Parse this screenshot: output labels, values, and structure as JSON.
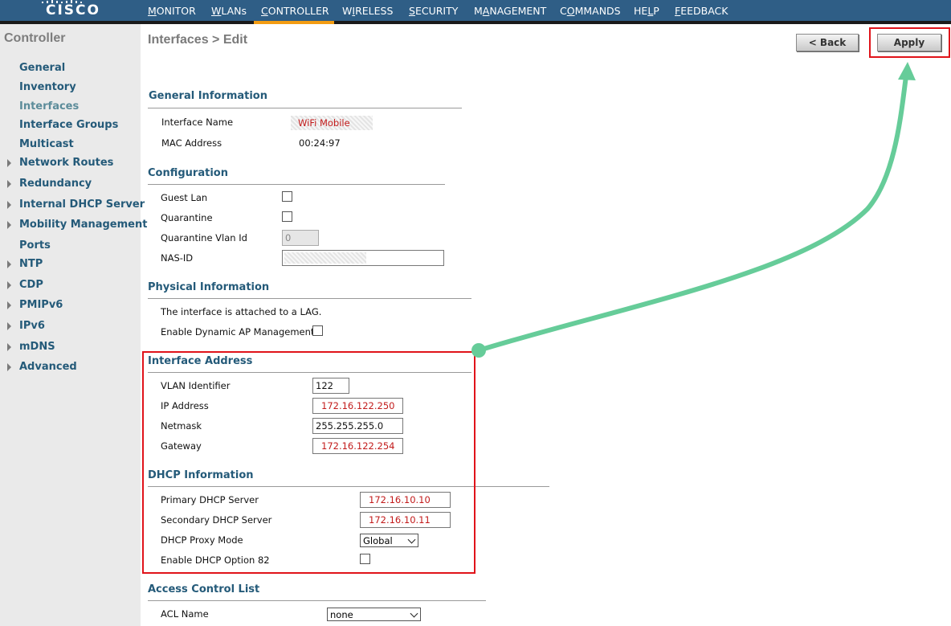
{
  "brand": {
    "logo_text": "CISCO"
  },
  "nav": {
    "items": [
      {
        "pre": "",
        "ul": "M",
        "post": "ONITOR"
      },
      {
        "pre": "",
        "ul": "W",
        "post": "LANs"
      },
      {
        "pre": "",
        "ul": "C",
        "post": "ONTROLLER"
      },
      {
        "pre": "W",
        "ul": "I",
        "post": "RELESS"
      },
      {
        "pre": "",
        "ul": "S",
        "post": "ECURITY"
      },
      {
        "pre": "M",
        "ul": "A",
        "post": "NAGEMENT"
      },
      {
        "pre": "C",
        "ul": "O",
        "post": "MMANDS"
      },
      {
        "pre": "HE",
        "ul": "L",
        "post": "P"
      },
      {
        "pre": "",
        "ul": "F",
        "post": "EEDBACK"
      }
    ],
    "active": "CONTROLLER",
    "active_color": "#f39c12"
  },
  "sidebar": {
    "title": "Controller",
    "items": [
      {
        "label": "General",
        "arrow": false
      },
      {
        "label": "Inventory",
        "arrow": false
      },
      {
        "label": "Interfaces",
        "arrow": false,
        "active": true
      },
      {
        "label": "Interface Groups",
        "arrow": false
      },
      {
        "label": "Multicast",
        "arrow": false
      },
      {
        "label": "Network Routes",
        "arrow": true
      },
      {
        "label": "Redundancy",
        "arrow": true
      },
      {
        "label": "Internal DHCP Server",
        "arrow": true
      },
      {
        "label": "Mobility Management",
        "arrow": true
      },
      {
        "label": "Ports",
        "arrow": false
      },
      {
        "label": "NTP",
        "arrow": true
      },
      {
        "label": "CDP",
        "arrow": true
      },
      {
        "label": "PMIPv6",
        "arrow": true
      },
      {
        "label": "IPv6",
        "arrow": true
      },
      {
        "label": "mDNS",
        "arrow": true
      },
      {
        "label": "Advanced",
        "arrow": true
      }
    ]
  },
  "page": {
    "title": "Interfaces > Edit",
    "back_label": "< Back",
    "apply_label": "Apply"
  },
  "general": {
    "heading": "General Information",
    "interface_name_label": "Interface Name",
    "interface_name_value": "WiFi Mobile",
    "mac_label": "MAC Address",
    "mac_value": "00:24:97"
  },
  "configuration": {
    "heading": "Configuration",
    "guest_lan_label": "Guest Lan",
    "guest_lan_checked": false,
    "quarantine_label": "Quarantine",
    "quarantine_checked": false,
    "quarantine_vlan_label": "Quarantine Vlan Id",
    "quarantine_vlan_value": "0",
    "nas_id_label": "NAS-ID",
    "nas_id_value": ""
  },
  "physical": {
    "heading": "Physical Information",
    "lag_text": "The interface is attached to a LAG.",
    "dynamic_ap_label": "Enable Dynamic AP Management",
    "dynamic_ap_checked": false
  },
  "interface_address": {
    "heading": "Interface Address",
    "vlan_label": "VLAN Identifier",
    "vlan_value": "122",
    "ip_label": "IP Address",
    "ip_value": "172.16.122.250",
    "netmask_label": "Netmask",
    "netmask_value": "255.255.255.0",
    "gateway_label": "Gateway",
    "gateway_value": "172.16.122.254"
  },
  "dhcp": {
    "heading": "DHCP Information",
    "primary_label": "Primary DHCP Server",
    "primary_value": "172.16.10.10",
    "secondary_label": "Secondary DHCP Server",
    "secondary_value": "172.16.10.11",
    "proxy_label": "DHCP Proxy Mode",
    "proxy_value": "Global",
    "option82_label": "Enable DHCP Option 82",
    "option82_checked": false
  },
  "acl": {
    "heading": "Access Control List",
    "acl_name_label": "ACL Name",
    "acl_name_value": "none"
  },
  "colors": {
    "topbar": "#2f5e86",
    "sidebar_link": "#245a79",
    "highlight": "#e0131a",
    "annotation_arrow": "#66cc99",
    "redacted_text": "#c21b1b"
  }
}
